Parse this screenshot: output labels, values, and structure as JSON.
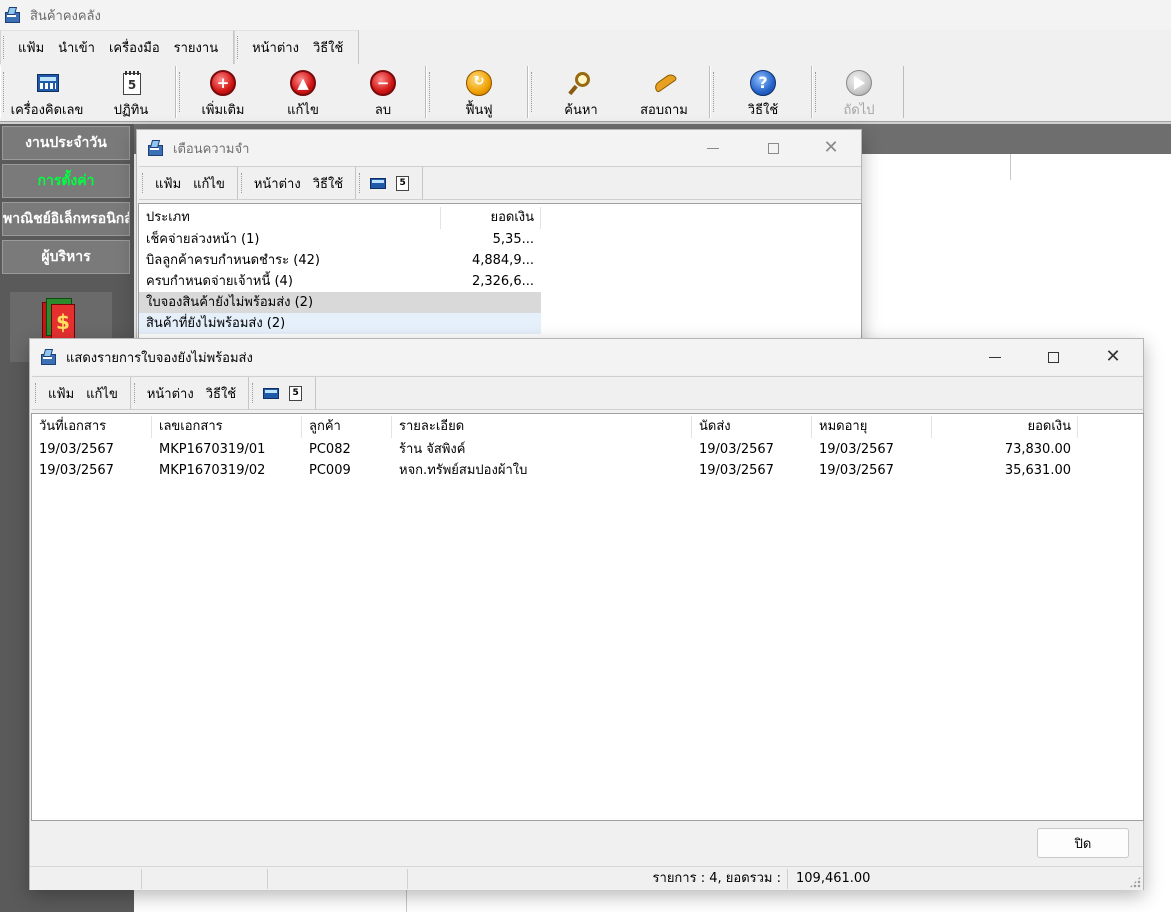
{
  "app": {
    "title": "สินค้าคงคลัง",
    "menu_groups": [
      [
        "แฟ้ม",
        "นำเข้า",
        "เครื่องมือ",
        "รายงาน"
      ],
      [
        "หน้าต่าง",
        "วิธีใช้"
      ]
    ],
    "toolbar": {
      "calculator": "เครื่องคิดเลข",
      "calendar": "ปฏิทิน",
      "calendar_num": "5",
      "add": "เพิ่มเติม",
      "edit": "แก้ไข",
      "delete": "ลบ",
      "restore": "ฟื้นฟู",
      "search": "ค้นหา",
      "inquire": "สอบถาม",
      "help": "วิธีใช้",
      "next": "ถัดไป"
    },
    "sidebar": {
      "items": [
        "งานประจำวัน",
        "การตั้งค่า",
        "พาณิชย์อิเล็กทรอนิกส์",
        "ผู้บริหาร"
      ],
      "active_index": 1,
      "book_glyph": "$"
    },
    "colors": {
      "sidebar_active": "#00ff40",
      "selected_row": "#d9d9d9",
      "hover_row": "#e5f0fb"
    }
  },
  "reminder_window": {
    "title": "เตือนความจำ",
    "menu_groups": [
      [
        "แฟ้ม",
        "แก้ไข"
      ],
      [
        "หน้าต่าง",
        "วิธีใช้"
      ]
    ],
    "columns": [
      "ประเภท",
      "ยอดเงิน"
    ],
    "rows": [
      {
        "type": "เช็คจ่ายล่วงหน้า (1)",
        "amount": "5,35..."
      },
      {
        "type": "บิลลูกค้าครบกำหนดชำระ (42)",
        "amount": "4,884,9..."
      },
      {
        "type": "ครบกำหนดจ่ายเจ้าหนี้ (4)",
        "amount": "2,326,6..."
      },
      {
        "type": "ใบจองสินค้ายังไม่พร้อมส่ง (2)",
        "amount": ""
      },
      {
        "type": "สินค้าที่ยังไม่พร้อมส่ง (2)",
        "amount": ""
      }
    ]
  },
  "orders_window": {
    "title": "แสดงรายการใบจองยังไม่พร้อมส่ง",
    "menu_groups": [
      [
        "แฟ้ม",
        "แก้ไข"
      ],
      [
        "หน้าต่าง",
        "วิธีใช้"
      ]
    ],
    "columns": [
      "วันที่เอกสาร",
      "เลขเอกสาร",
      "ลูกค้า",
      "รายละเอียด",
      "นัดส่ง",
      "หมดอายุ",
      "ยอดเงิน"
    ],
    "rows": [
      [
        "19/03/2567",
        "MKP1670319/01",
        "PC082",
        "ร้าน จัสพิงค์",
        "19/03/2567",
        "19/03/2567",
        "73,830.00"
      ],
      [
        "19/03/2567",
        "MKP1670319/02",
        "PC009",
        "หจก.ทรัพย์สมปองผ้าใบ",
        "19/03/2567",
        "19/03/2567",
        "35,631.00"
      ]
    ],
    "close_label": "ปิด",
    "status_label": "รายการ : 4, ยอดรวม :",
    "status_total": "109,461.00"
  }
}
